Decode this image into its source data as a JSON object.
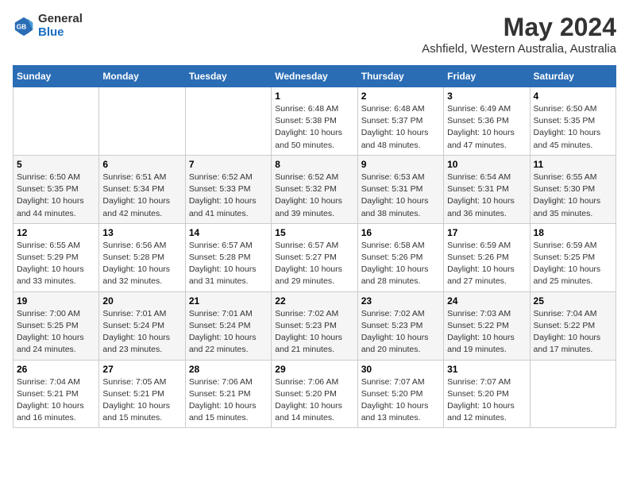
{
  "logo": {
    "line1": "General",
    "line2": "Blue"
  },
  "title": "May 2024",
  "subtitle": "Ashfield, Western Australia, Australia",
  "days_of_week": [
    "Sunday",
    "Monday",
    "Tuesday",
    "Wednesday",
    "Thursday",
    "Friday",
    "Saturday"
  ],
  "weeks": [
    [
      {
        "day": "",
        "info": ""
      },
      {
        "day": "",
        "info": ""
      },
      {
        "day": "",
        "info": ""
      },
      {
        "day": "1",
        "info": "Sunrise: 6:48 AM\nSunset: 5:38 PM\nDaylight: 10 hours\nand 50 minutes."
      },
      {
        "day": "2",
        "info": "Sunrise: 6:48 AM\nSunset: 5:37 PM\nDaylight: 10 hours\nand 48 minutes."
      },
      {
        "day": "3",
        "info": "Sunrise: 6:49 AM\nSunset: 5:36 PM\nDaylight: 10 hours\nand 47 minutes."
      },
      {
        "day": "4",
        "info": "Sunrise: 6:50 AM\nSunset: 5:35 PM\nDaylight: 10 hours\nand 45 minutes."
      }
    ],
    [
      {
        "day": "5",
        "info": "Sunrise: 6:50 AM\nSunset: 5:35 PM\nDaylight: 10 hours\nand 44 minutes."
      },
      {
        "day": "6",
        "info": "Sunrise: 6:51 AM\nSunset: 5:34 PM\nDaylight: 10 hours\nand 42 minutes."
      },
      {
        "day": "7",
        "info": "Sunrise: 6:52 AM\nSunset: 5:33 PM\nDaylight: 10 hours\nand 41 minutes."
      },
      {
        "day": "8",
        "info": "Sunrise: 6:52 AM\nSunset: 5:32 PM\nDaylight: 10 hours\nand 39 minutes."
      },
      {
        "day": "9",
        "info": "Sunrise: 6:53 AM\nSunset: 5:31 PM\nDaylight: 10 hours\nand 38 minutes."
      },
      {
        "day": "10",
        "info": "Sunrise: 6:54 AM\nSunset: 5:31 PM\nDaylight: 10 hours\nand 36 minutes."
      },
      {
        "day": "11",
        "info": "Sunrise: 6:55 AM\nSunset: 5:30 PM\nDaylight: 10 hours\nand 35 minutes."
      }
    ],
    [
      {
        "day": "12",
        "info": "Sunrise: 6:55 AM\nSunset: 5:29 PM\nDaylight: 10 hours\nand 33 minutes."
      },
      {
        "day": "13",
        "info": "Sunrise: 6:56 AM\nSunset: 5:28 PM\nDaylight: 10 hours\nand 32 minutes."
      },
      {
        "day": "14",
        "info": "Sunrise: 6:57 AM\nSunset: 5:28 PM\nDaylight: 10 hours\nand 31 minutes."
      },
      {
        "day": "15",
        "info": "Sunrise: 6:57 AM\nSunset: 5:27 PM\nDaylight: 10 hours\nand 29 minutes."
      },
      {
        "day": "16",
        "info": "Sunrise: 6:58 AM\nSunset: 5:26 PM\nDaylight: 10 hours\nand 28 minutes."
      },
      {
        "day": "17",
        "info": "Sunrise: 6:59 AM\nSunset: 5:26 PM\nDaylight: 10 hours\nand 27 minutes."
      },
      {
        "day": "18",
        "info": "Sunrise: 6:59 AM\nSunset: 5:25 PM\nDaylight: 10 hours\nand 25 minutes."
      }
    ],
    [
      {
        "day": "19",
        "info": "Sunrise: 7:00 AM\nSunset: 5:25 PM\nDaylight: 10 hours\nand 24 minutes."
      },
      {
        "day": "20",
        "info": "Sunrise: 7:01 AM\nSunset: 5:24 PM\nDaylight: 10 hours\nand 23 minutes."
      },
      {
        "day": "21",
        "info": "Sunrise: 7:01 AM\nSunset: 5:24 PM\nDaylight: 10 hours\nand 22 minutes."
      },
      {
        "day": "22",
        "info": "Sunrise: 7:02 AM\nSunset: 5:23 PM\nDaylight: 10 hours\nand 21 minutes."
      },
      {
        "day": "23",
        "info": "Sunrise: 7:02 AM\nSunset: 5:23 PM\nDaylight: 10 hours\nand 20 minutes."
      },
      {
        "day": "24",
        "info": "Sunrise: 7:03 AM\nSunset: 5:22 PM\nDaylight: 10 hours\nand 19 minutes."
      },
      {
        "day": "25",
        "info": "Sunrise: 7:04 AM\nSunset: 5:22 PM\nDaylight: 10 hours\nand 17 minutes."
      }
    ],
    [
      {
        "day": "26",
        "info": "Sunrise: 7:04 AM\nSunset: 5:21 PM\nDaylight: 10 hours\nand 16 minutes."
      },
      {
        "day": "27",
        "info": "Sunrise: 7:05 AM\nSunset: 5:21 PM\nDaylight: 10 hours\nand 15 minutes."
      },
      {
        "day": "28",
        "info": "Sunrise: 7:06 AM\nSunset: 5:21 PM\nDaylight: 10 hours\nand 15 minutes."
      },
      {
        "day": "29",
        "info": "Sunrise: 7:06 AM\nSunset: 5:20 PM\nDaylight: 10 hours\nand 14 minutes."
      },
      {
        "day": "30",
        "info": "Sunrise: 7:07 AM\nSunset: 5:20 PM\nDaylight: 10 hours\nand 13 minutes."
      },
      {
        "day": "31",
        "info": "Sunrise: 7:07 AM\nSunset: 5:20 PM\nDaylight: 10 hours\nand 12 minutes."
      },
      {
        "day": "",
        "info": ""
      }
    ]
  ]
}
